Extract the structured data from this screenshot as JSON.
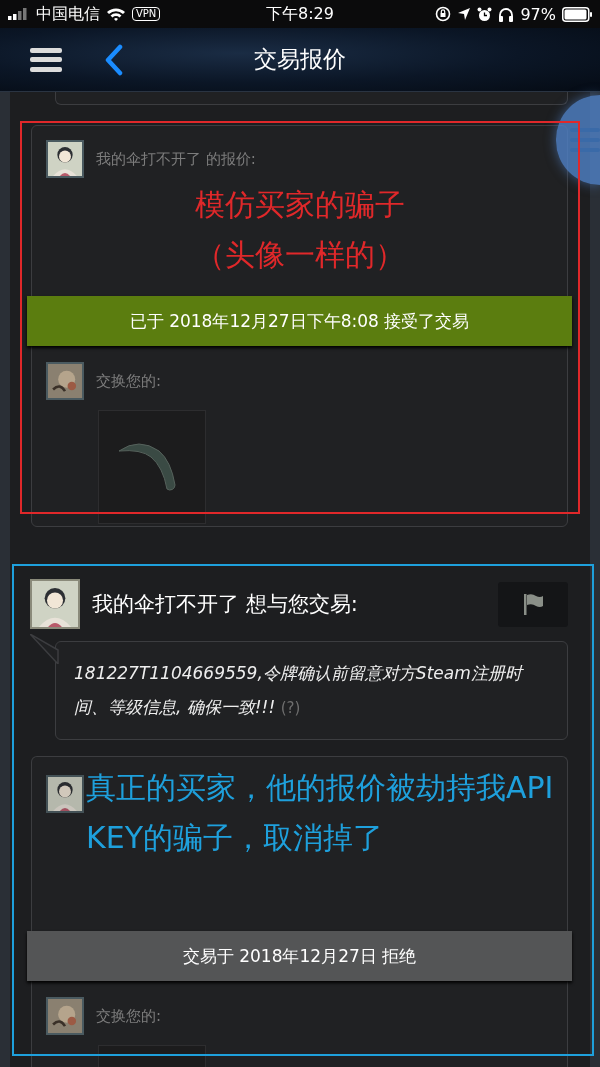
{
  "status_bar": {
    "carrier": "中国电信",
    "vpn": "VPN",
    "time": "下午8:29",
    "battery": "97%"
  },
  "nav": {
    "title": "交易报价"
  },
  "offers": [
    {
      "color": "#e0282a",
      "note": [
        "模仿买家的骗子",
        "（头像一样的）"
      ],
      "card": {
        "header": "我的伞打不开了 的报价:",
        "status": {
          "kind": "accepted",
          "text": "已于 2018年12月27日下午8:08 接受了交易"
        },
        "exchange_label": "交换您的:"
      }
    },
    {
      "color": "#1ea0dc",
      "intro": {
        "title": "我的伞打不开了 想与您交易:",
        "message": "181227T1104669559,令牌确认前留意对方Steam注册时间、等级信息, 确保一致!!!",
        "help": "(?)"
      },
      "note": [
        "真正的买家，他的报价被劫持我API",
        "KEY的骗子，取消掉了"
      ],
      "card": {
        "status": {
          "kind": "declined",
          "text": "交易于 2018年12月27日 拒绝"
        },
        "exchange_label": "交换您的:"
      }
    }
  ]
}
